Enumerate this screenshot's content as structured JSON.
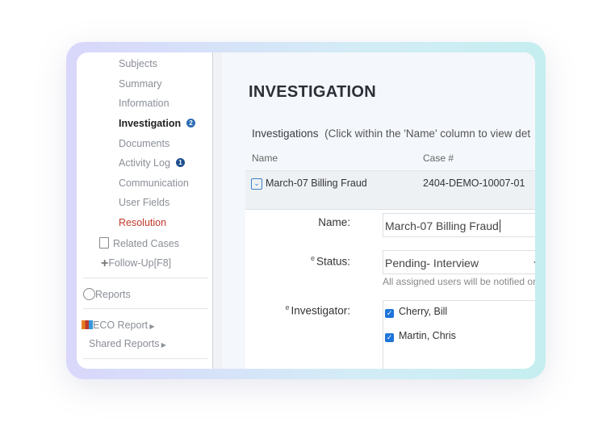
{
  "sidebar": {
    "items": [
      {
        "label": "Subjects"
      },
      {
        "label": "Summary"
      },
      {
        "label": "Information"
      },
      {
        "label": "Investigation",
        "badge": "2"
      },
      {
        "label": "Documents"
      },
      {
        "label": "Activity Log",
        "badge": "1"
      },
      {
        "label": "Communication"
      },
      {
        "label": "User Fields"
      },
      {
        "label": "Resolution"
      }
    ],
    "related_cases": "Related Cases",
    "follow_up": "Follow-Up[F8]",
    "reports": "Reports",
    "eco_report": "ECO Report",
    "shared_reports": "Shared Reports"
  },
  "main": {
    "title": "INVESTIGATION",
    "intro": "Investigations",
    "intro_hint": "(Click within the 'Name' column to view det",
    "columns": [
      "Name",
      "Case #"
    ],
    "row": {
      "name": "March-07 Billing Fraud",
      "case": "2404-DEMO-10007-01"
    },
    "form": {
      "name_label": "Name:",
      "name_value": "March-07 Billing Fraud",
      "status_label": "Status:",
      "status_value": "Pending- Interview",
      "status_hint": "All assigned users will be notified on statu",
      "investigator_label": "Investigator:",
      "editable_marker": "e",
      "investigators": [
        "Cherry, Bill",
        "Martin, Chris"
      ]
    }
  }
}
